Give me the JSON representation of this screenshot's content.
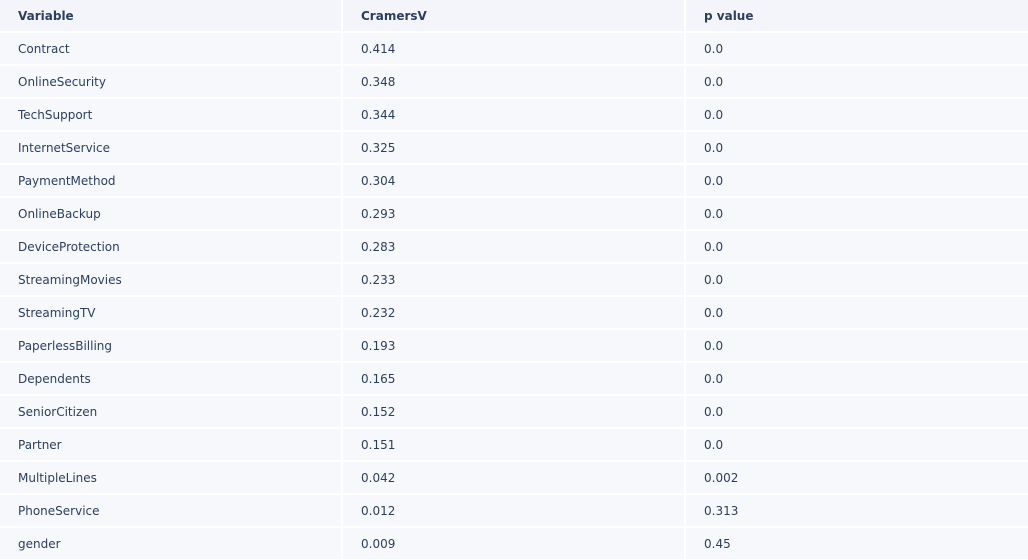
{
  "chart_data": {
    "type": "table",
    "columns": [
      "Variable",
      "CramersV",
      "p value"
    ],
    "rows": [
      [
        "Contract",
        "0.414",
        "0.0"
      ],
      [
        "OnlineSecurity",
        "0.348",
        "0.0"
      ],
      [
        "TechSupport",
        "0.344",
        "0.0"
      ],
      [
        "InternetService",
        "0.325",
        "0.0"
      ],
      [
        "PaymentMethod",
        "0.304",
        "0.0"
      ],
      [
        "OnlineBackup",
        "0.293",
        "0.0"
      ],
      [
        "DeviceProtection",
        "0.283",
        "0.0"
      ],
      [
        "StreamingMovies",
        "0.233",
        "0.0"
      ],
      [
        "StreamingTV",
        "0.232",
        "0.0"
      ],
      [
        "PaperlessBilling",
        "0.193",
        "0.0"
      ],
      [
        "Dependents",
        "0.165",
        "0.0"
      ],
      [
        "SeniorCitizen",
        "0.152",
        "0.0"
      ],
      [
        "Partner",
        "0.151",
        "0.0"
      ],
      [
        "MultipleLines",
        "0.042",
        "0.002"
      ],
      [
        "PhoneService",
        "0.012",
        "0.313"
      ],
      [
        "gender",
        "0.009",
        "0.45"
      ]
    ],
    "colors": {
      "cell_fill": "#f7f8fc",
      "header_fill": "#f3f5fb",
      "text": "#2a3f5f"
    }
  }
}
